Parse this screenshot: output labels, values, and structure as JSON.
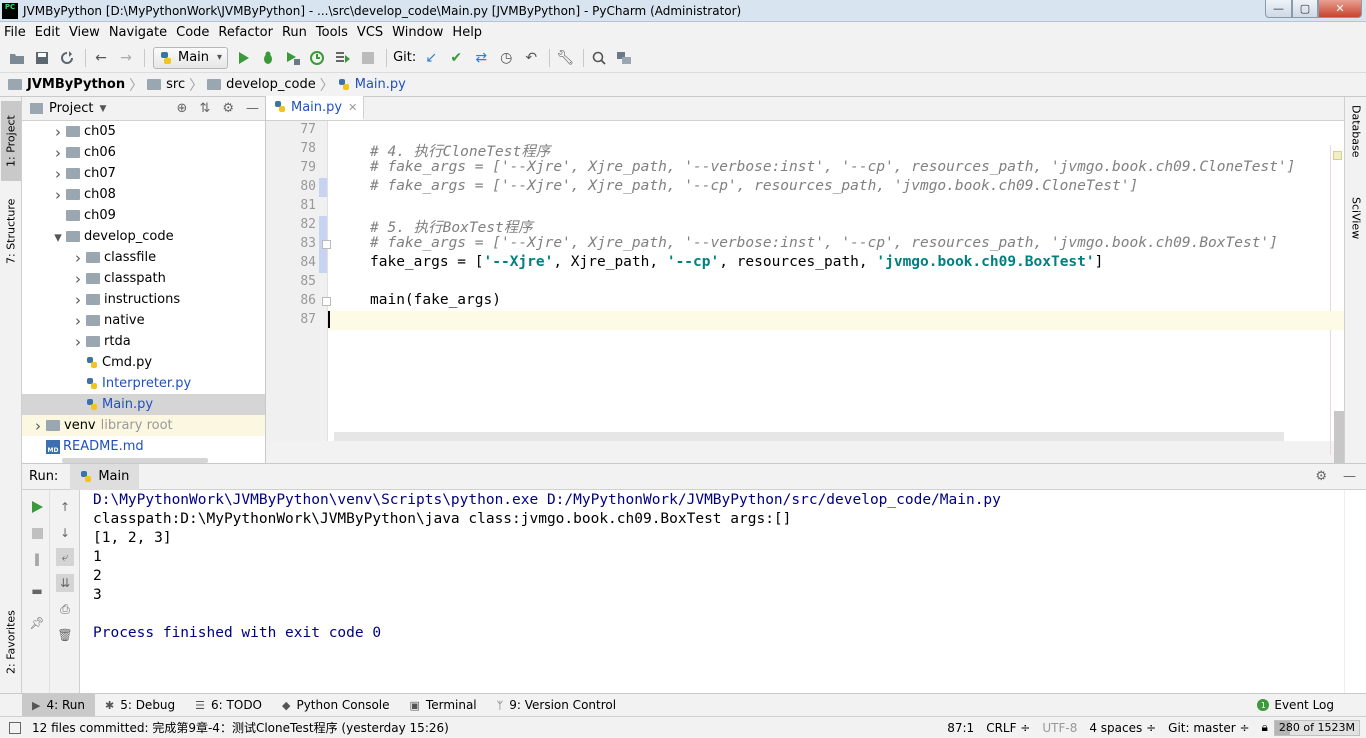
{
  "window": {
    "title": "JVMByPython [D:\\MyPythonWork\\JVMByPython] - ...\\src\\develop_code\\Main.py [JVMByPython] - PyCharm (Administrator)",
    "app_icon_text": "PC"
  },
  "menu": [
    "File",
    "Edit",
    "View",
    "Navigate",
    "Code",
    "Refactor",
    "Run",
    "Tools",
    "VCS",
    "Window",
    "Help"
  ],
  "toolbar": {
    "run_config": "Main",
    "git_label": "Git:"
  },
  "breadcrumb": [
    "JVMByPython",
    "src",
    "develop_code",
    "Main.py"
  ],
  "left_tabs": {
    "project": "1: Project",
    "structure": "7: Structure",
    "favorites": "2: Favorites"
  },
  "right_tabs": {
    "database": "Database",
    "sciview": "SciView"
  },
  "project_panel": {
    "title": "Project",
    "tree": [
      {
        "label": "ch05",
        "type": "folder",
        "depth": 2,
        "arrow": "›"
      },
      {
        "label": "ch06",
        "type": "folder",
        "depth": 2,
        "arrow": "›"
      },
      {
        "label": "ch07",
        "type": "folder",
        "depth": 2,
        "arrow": "›"
      },
      {
        "label": "ch08",
        "type": "folder",
        "depth": 2,
        "arrow": "›"
      },
      {
        "label": "ch09",
        "type": "folder",
        "depth": 2,
        "arrow": ""
      },
      {
        "label": "develop_code",
        "type": "folder",
        "depth": 2,
        "arrow": "⌄"
      },
      {
        "label": "classfile",
        "type": "folder",
        "depth": 3,
        "arrow": "›"
      },
      {
        "label": "classpath",
        "type": "folder",
        "depth": 3,
        "arrow": "›"
      },
      {
        "label": "instructions",
        "type": "folder",
        "depth": 3,
        "arrow": "›"
      },
      {
        "label": "native",
        "type": "folder",
        "depth": 3,
        "arrow": "›"
      },
      {
        "label": "rtda",
        "type": "folder",
        "depth": 3,
        "arrow": "›"
      },
      {
        "label": "Cmd.py",
        "type": "py",
        "depth": 3,
        "arrow": ""
      },
      {
        "label": "Interpreter.py",
        "type": "py-blue",
        "depth": 3,
        "arrow": ""
      },
      {
        "label": "Main.py",
        "type": "py-blue-selected",
        "depth": 3,
        "arrow": ""
      },
      {
        "label": "venv",
        "type": "venv",
        "depth": 1,
        "arrow": "›",
        "suffix": "library root"
      },
      {
        "label": "README.md",
        "type": "md",
        "depth": 1,
        "arrow": ""
      }
    ]
  },
  "editor": {
    "tab": "Main.py",
    "lines": [
      {
        "num": "77",
        "code": ""
      },
      {
        "num": "78",
        "code": "# 4. 执行CloneTest程序",
        "kind": "comment"
      },
      {
        "num": "79",
        "code": "# fake_args = ['--Xjre', Xjre_path, '--verbose:inst', '--cp', resources_path, 'jvmgo.book.ch09.CloneTest']",
        "kind": "comment"
      },
      {
        "num": "80",
        "code": "# fake_args = ['--Xjre', Xjre_path, '--cp', resources_path, 'jvmgo.book.ch09.CloneTest']",
        "kind": "comment"
      },
      {
        "num": "81",
        "code": ""
      },
      {
        "num": "82",
        "code": "# 5. 执行BoxTest程序",
        "kind": "comment"
      },
      {
        "num": "83",
        "code": "# fake_args = ['--Xjre', Xjre_path, '--verbose:inst', '--cp', resources_path, 'jvmgo.book.ch09.BoxTest']",
        "kind": "comment"
      },
      {
        "num": "84",
        "code": "",
        "kind": "code84"
      },
      {
        "num": "85",
        "code": ""
      },
      {
        "num": "86",
        "code": "main(fake_args)",
        "kind": "plain"
      },
      {
        "num": "87",
        "code": "",
        "kind": "current"
      }
    ],
    "line84": {
      "a": "fake_args = [",
      "s1": "'--Xjre'",
      "b": ", Xjre_path, ",
      "s2": "'--cp'",
      "c": ", resources_path, ",
      "s3": "'jvmgo.book.ch09.BoxTest'",
      "d": "]"
    }
  },
  "run_panel": {
    "label": "Run:",
    "tab": "Main",
    "output": [
      {
        "text": "D:\\MyPythonWork\\JVMByPython\\venv\\Scripts\\python.exe D:/MyPythonWork/JVMByPython/src/develop_code/Main.py",
        "kind": "cmd"
      },
      {
        "text": "classpath:D:\\MyPythonWork\\JVMByPython\\java class:jvmgo.book.ch09.BoxTest args:[]",
        "kind": "out"
      },
      {
        "text": "[1, 2, 3]",
        "kind": "out"
      },
      {
        "text": "1",
        "kind": "out"
      },
      {
        "text": "2",
        "kind": "out"
      },
      {
        "text": "3",
        "kind": "out"
      },
      {
        "text": "",
        "kind": "out"
      },
      {
        "text": "Process finished with exit code 0",
        "kind": "done"
      }
    ]
  },
  "bottom_tabs": [
    {
      "label": "4: Run",
      "icon": "▶",
      "active": true
    },
    {
      "label": "5: Debug",
      "icon": "✱"
    },
    {
      "label": "6: TODO",
      "icon": "☰"
    },
    {
      "label": "Python Console",
      "icon": "◆"
    },
    {
      "label": "Terminal",
      "icon": "▣"
    },
    {
      "label": "9: Version Control",
      "icon": "ᛘ"
    }
  ],
  "event_log": "Event Log",
  "status": {
    "message": "12 files committed: 完成第9章-4：测试CloneTest程序 (yesterday 15:26)",
    "position": "87:1",
    "line_sep": "CRLF ÷",
    "encoding": "UTF-8",
    "indent": "4 spaces ÷",
    "git": "Git: master ÷",
    "memory": "280 of 1523M",
    "memory_fraction": 0.18
  }
}
